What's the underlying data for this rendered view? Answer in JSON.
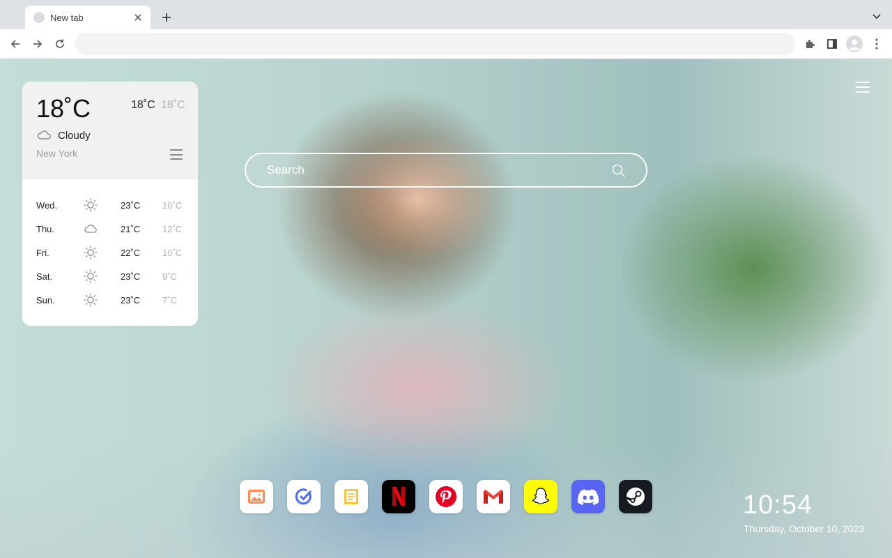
{
  "browser": {
    "tab_title": "New tab",
    "omnibox_value": "",
    "omnibox_placeholder": ""
  },
  "weather": {
    "current_temp": "18˚C",
    "high": "18˚C",
    "low": "18˚C",
    "condition": "Cloudy",
    "condition_icon": "cloud-icon",
    "location": "New York",
    "forecast": [
      {
        "day": "Wed.",
        "icon": "sun-icon",
        "high": "23˚C",
        "low": "10˚C"
      },
      {
        "day": "Thu.",
        "icon": "cloud-icon",
        "high": "21˚C",
        "low": "12˚C"
      },
      {
        "day": "Fri.",
        "icon": "sun-icon",
        "high": "22˚C",
        "low": "10˚C"
      },
      {
        "day": "Sat.",
        "icon": "sun-icon",
        "high": "23˚C",
        "low": "9˚C"
      },
      {
        "day": "Sun.",
        "icon": "sun-icon",
        "high": "23˚C",
        "low": "7˚C"
      }
    ]
  },
  "search": {
    "placeholder": "Search"
  },
  "dock": {
    "apps": [
      {
        "name": "photos",
        "icon": "image-icon",
        "bg": "#ffffff"
      },
      {
        "name": "tasks",
        "icon": "check-circle-icon",
        "bg": "#ffffff"
      },
      {
        "name": "notes",
        "icon": "notes-icon",
        "bg": "#ffffff"
      },
      {
        "name": "netflix",
        "icon": "netflix-icon",
        "bg": "#000000"
      },
      {
        "name": "pinterest",
        "icon": "pinterest-icon",
        "bg": "#ffffff"
      },
      {
        "name": "gmail",
        "icon": "gmail-icon",
        "bg": "#ffffff"
      },
      {
        "name": "snapchat",
        "icon": "snapchat-icon",
        "bg": "#fffc00"
      },
      {
        "name": "discord",
        "icon": "discord-icon",
        "bg": "#5865f2"
      },
      {
        "name": "steam",
        "icon": "steam-icon",
        "bg": "#171a21"
      }
    ]
  },
  "clock": {
    "time": "10:54",
    "date": "Thursday, October 10, 2023"
  },
  "colors": {
    "accent_netflix": "#e50914",
    "accent_pinterest": "#e60023",
    "accent_discord": "#5865f2",
    "accent_snapchat": "#fffc00"
  }
}
